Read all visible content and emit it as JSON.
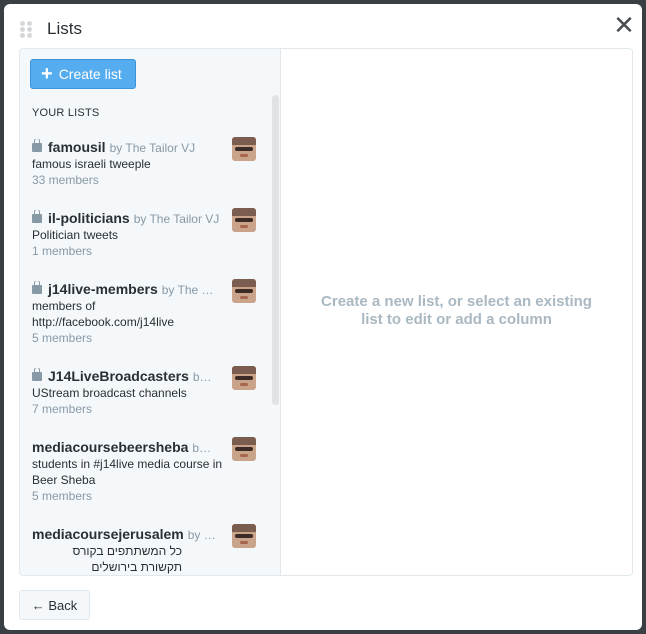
{
  "modal": {
    "title": "Lists",
    "close_glyph": "✕"
  },
  "toolbar": {
    "create_label": "Create list",
    "create_icon": "plus-icon"
  },
  "sidebar": {
    "section_label": "YOUR LISTS",
    "items": [
      {
        "name": "famousil",
        "by": "by The Tailor VJ",
        "locked": true,
        "description": "famous israeli tweeple",
        "members": "33 members"
      },
      {
        "name": "il-politicians",
        "by": "by The Tailor VJ",
        "locked": true,
        "description": "Politician tweets",
        "members": "1 members"
      },
      {
        "name": "j14live-members",
        "by": "by The …",
        "locked": true,
        "description": "members of http://facebook.com/j14live",
        "members": "5 members"
      },
      {
        "name": "J14LiveBroadcasters",
        "by": "b…",
        "locked": true,
        "description": "UStream broadcast channels",
        "members": "7 members"
      },
      {
        "name": "mediacoursebeersheba",
        "by": "b…",
        "locked": false,
        "description": "students in #j14live media course in Beer Sheba",
        "members": "5 members"
      },
      {
        "name": "mediacoursejerusalem",
        "by": "by …",
        "locked": false,
        "description": "כל המשתתפים בקורס תקשורת בירושלים",
        "members": ""
      }
    ]
  },
  "main": {
    "empty_message": "Create a new list, or select an existing list to edit or add a column"
  },
  "footer": {
    "back_label": "← Back"
  },
  "colors": {
    "accent": "#55acee",
    "muted": "#8899a6",
    "placeholder": "#aab8c2"
  }
}
